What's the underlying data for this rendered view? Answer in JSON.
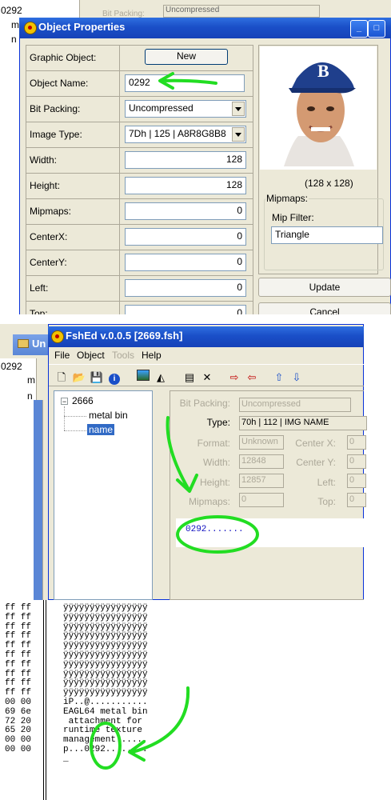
{
  "bg_window": {
    "tree_value": "0292",
    "tree_node1": "m",
    "tree_node2": "n",
    "field_label": "Bit Packing:",
    "field_value": "Uncompressed"
  },
  "object_properties": {
    "title": "Object Properties",
    "rows": [
      {
        "label": "Graphic Object:"
      },
      {
        "label": "Object Name:",
        "value": "0292"
      },
      {
        "label": "Bit Packing:",
        "value": "Uncompressed"
      },
      {
        "label": "Image Type:",
        "value": "7Dh | 125 | A8R8G8B8"
      },
      {
        "label": "Width:",
        "value": "128"
      },
      {
        "label": "Height:",
        "value": "128"
      },
      {
        "label": "Mipmaps:",
        "value": "0"
      },
      {
        "label": "CenterX:",
        "value": "0"
      },
      {
        "label": "CenterY:",
        "value": "0"
      },
      {
        "label": "Left:",
        "value": "0"
      },
      {
        "label": "Top:",
        "value": "0"
      }
    ],
    "new_button": "New",
    "image_size": "(128 x 128)",
    "mipmaps_group": "Mipmaps:",
    "mip_filter_label": "Mip Filter:",
    "mip_filter_value": "Triangle",
    "update_button": "Update",
    "cancel_button": "Cancel"
  },
  "bg_window2": {
    "title": "Un",
    "tree_value": "0292",
    "tree_node1": "m",
    "tree_node2": "n"
  },
  "fshed": {
    "title": "FshEd v.0.0.5 [2669.fsh]",
    "menu": [
      "File",
      "Object",
      "Tools",
      "Help"
    ],
    "tree": {
      "root": "2666",
      "child1": "metal bin",
      "child2": "name"
    },
    "props": {
      "bit_packing_label": "Bit Packing:",
      "bit_packing_value": "Uncompressed",
      "type_label": "Type:",
      "type_value": "70h | 112 | IMG NAME",
      "format_label": "Format:",
      "format_value": "Unknown",
      "width_label": "Width:",
      "width_value": "12848",
      "height_label": "Height:",
      "height_value": "12857",
      "mipmaps_label": "Mipmaps:",
      "mipmaps_value": "0",
      "centerx_label": "Center X:",
      "centerx_value": "0",
      "centery_label": "Center Y:",
      "centery_value": "0",
      "left_label": "Left:",
      "left_value": "0",
      "top_label": "Top:",
      "top_value": "0"
    },
    "preview_text": "0292......."
  },
  "hex": {
    "hex_column": "ff ff\nff ff\nff ff\nff ff\nff ff\nff ff\nff ff\nff ff\nff ff\nff ff\n00 00\n69 6e\n72 20\n65 20\n00 00\n00 00",
    "ascii_column": "ÿÿÿÿÿÿÿÿÿÿÿÿÿÿÿÿ\nÿÿÿÿÿÿÿÿÿÿÿÿÿÿÿÿ\nÿÿÿÿÿÿÿÿÿÿÿÿÿÿÿÿ\nÿÿÿÿÿÿÿÿÿÿÿÿÿÿÿÿ\nÿÿÿÿÿÿÿÿÿÿÿÿÿÿÿÿ\nÿÿÿÿÿÿÿÿÿÿÿÿÿÿÿÿ\nÿÿÿÿÿÿÿÿÿÿÿÿÿÿÿÿ\nÿÿÿÿÿÿÿÿÿÿÿÿÿÿÿÿ\nÿÿÿÿÿÿÿÿÿÿÿÿÿÿÿÿ\nÿÿÿÿÿÿÿÿÿÿÿÿÿÿÿÿ\niP..@...........\nEAGL64 metal bin\n attachment for\nruntime texture\nmanagement......\np...0292........\n_"
  },
  "colors": {
    "annotation_green": "#22dd22",
    "xp_title_blue": "#1a4fc8",
    "xp_face": "#ece9d8",
    "selection_blue": "#316ac5"
  }
}
